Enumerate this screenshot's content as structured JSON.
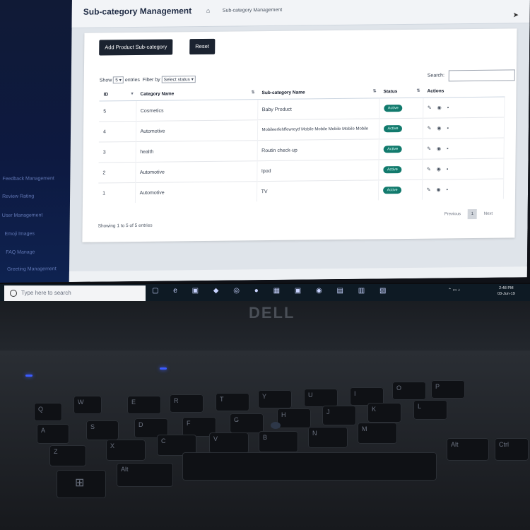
{
  "page": {
    "title": "Sub-category Management",
    "breadcrumb": "Sub-category Management"
  },
  "sidebar": {
    "items": [
      {
        "label": "Feedback Management"
      },
      {
        "label": "Review Rating"
      },
      {
        "label": "User Management"
      },
      {
        "label": "Emoji Images"
      },
      {
        "label": "FAQ Manage"
      },
      {
        "label": "Greeting Management"
      }
    ]
  },
  "toolbar": {
    "add_label": "Add Product Sub-category",
    "reset_label": "Reset"
  },
  "controls": {
    "show_label": "Show",
    "show_value": "5",
    "entries_label": "entries",
    "filter_label": "Filter by",
    "filter_value": "Select status",
    "search_label": "Search:"
  },
  "table": {
    "headers": [
      "ID",
      "Category Name",
      "Sub-category Name",
      "Status",
      "Actions"
    ],
    "rows": [
      {
        "id": "5",
        "category": "Cosmetics",
        "subcategory": "Baby Product",
        "status": "Active"
      },
      {
        "id": "4",
        "category": "Automotive",
        "subcategory": "Mobileerfehffewreytf Mobile Mobile Mobile Mobile Mobile",
        "status": "Active"
      },
      {
        "id": "3",
        "category": "health",
        "subcategory": "Routin check-up",
        "status": "Active"
      },
      {
        "id": "2",
        "category": "Automotive",
        "subcategory": "Ipod",
        "status": "Active"
      },
      {
        "id": "1",
        "category": "Automotive",
        "subcategory": "TV",
        "status": "Active"
      }
    ]
  },
  "pagination": {
    "summary": "Showing 1 to 5 of 5 entries",
    "previous": "Previous",
    "page": "1",
    "next": "Next"
  },
  "taskbar": {
    "search_placeholder": "Type here to search",
    "time": "2:48 PM",
    "date": "03-Jun-19"
  },
  "device": {
    "brand": "DELL"
  },
  "keyboard": {
    "keys": [
      "Q",
      "W",
      "E",
      "R",
      "T",
      "Y",
      "U",
      "I",
      "O",
      "P",
      "A",
      "S",
      "D",
      "F",
      "G",
      "H",
      "J",
      "K",
      "L",
      "Z",
      "X",
      "C",
      "V",
      "B",
      "N",
      "M",
      "Alt",
      "Alt",
      "Ctrl"
    ]
  },
  "colors": {
    "sidebar": "#0d1940",
    "status_badge": "#127a6d",
    "button_dark": "#1b2330",
    "taskbar": "#0e1a24"
  },
  "icons": [
    "home-icon",
    "sort-icon",
    "edit-icon",
    "view-icon",
    "delete-icon",
    "search-icon",
    "windows-icon"
  ]
}
